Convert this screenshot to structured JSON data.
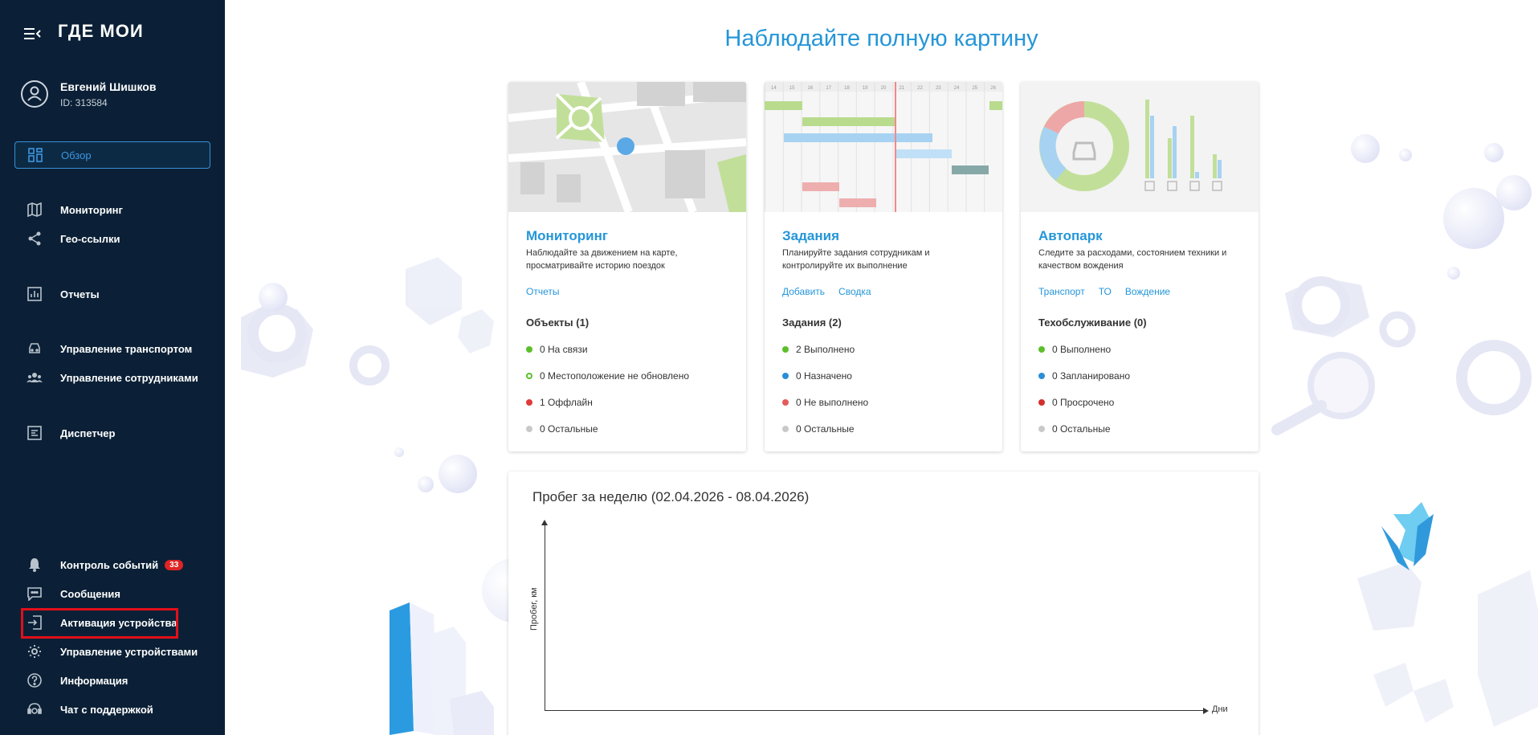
{
  "sidebar": {
    "logo": "ГДЕ МОИ",
    "user": {
      "name": "Евгений Шишков",
      "id": "ID: 313584"
    },
    "items": [
      {
        "label": "Обзор",
        "icon": "dashboard-icon"
      },
      {
        "label": "Мониторинг",
        "icon": "map-icon"
      },
      {
        "label": "Гео-ссылки",
        "icon": "share-icon"
      },
      {
        "label": "Отчеты",
        "icon": "chart-icon"
      },
      {
        "label": "Управление транспортом",
        "icon": "car-icon"
      },
      {
        "label": "Управление сотрудниками",
        "icon": "people-icon"
      },
      {
        "label": "Диспетчер",
        "icon": "dispatcher-icon"
      },
      {
        "label": "Контроль событий",
        "icon": "bell-icon",
        "badge": "33"
      },
      {
        "label": "Сообщения",
        "icon": "message-icon"
      },
      {
        "label": "Активация устройства",
        "icon": "login-icon"
      },
      {
        "label": "Управление устройствами",
        "icon": "gear-icon"
      },
      {
        "label": "Информация",
        "icon": "help-icon"
      },
      {
        "label": "Чат с поддержкой",
        "icon": "support-icon"
      }
    ]
  },
  "main": {
    "title": "Наблюдайте полную картину",
    "cards": [
      {
        "title": "Мониторинг",
        "desc": "Наблюдайте за движением на карте, просматривайте историю поездок",
        "links": [
          "Отчеты"
        ],
        "subtitle": "Объекты (1)",
        "stats": [
          {
            "text": "0 На связи",
            "color": "#5cbf2a"
          },
          {
            "text": "0 Местоположение не обновлено",
            "color": "#5cbf2a",
            "hollow": true
          },
          {
            "text": "1 Оффлайн",
            "color": "#e03a3a"
          },
          {
            "text": "0 Остальные",
            "color": "#c9c9c9"
          }
        ]
      },
      {
        "title": "Задания",
        "desc": "Планируйте задания сотрудникам и контролируйте их выполнение",
        "links": [
          "Добавить",
          "Сводка"
        ],
        "subtitle": "Задания (2)",
        "stats": [
          {
            "text": "2 Выполнено",
            "color": "#5cbf2a"
          },
          {
            "text": "0 Назначено",
            "color": "#2a8fd6"
          },
          {
            "text": "0 Не выполнено",
            "color": "#e35b5b"
          },
          {
            "text": "0 Остальные",
            "color": "#c9c9c9"
          }
        ]
      },
      {
        "title": "Автопарк",
        "desc": "Следите за расходами, состоянием техники и качеством вождения",
        "links": [
          "Транспорт",
          "ТО",
          "Вождение"
        ],
        "subtitle": "Техобслуживание (0)",
        "stats": [
          {
            "text": "0 Выполнено",
            "color": "#5cbf2a"
          },
          {
            "text": "0 Запланировано",
            "color": "#2a8fd6"
          },
          {
            "text": "0 Просрочено",
            "color": "#d32f2f"
          },
          {
            "text": "0 Остальные",
            "color": "#c9c9c9"
          }
        ]
      }
    ],
    "gantt_days": [
      "14",
      "15",
      "16",
      "17",
      "18",
      "19",
      "20",
      "21",
      "22",
      "23",
      "24",
      "25",
      "26"
    ],
    "chart": {
      "title": "Пробег за неделю (02.04.2026 - 08.04.2026)",
      "ylabel": "Пробег, км",
      "xlabel": "Дни"
    }
  }
}
